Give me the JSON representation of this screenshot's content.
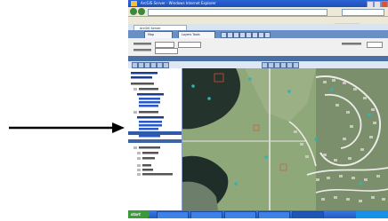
{
  "colors": {
    "arrow": "#000000",
    "titlebar": "#2a64d6",
    "taskbar": "#2f6fd8",
    "panel_header": "#3c65a8",
    "selected_row": "#2f5aa8",
    "map_water": "#1f2e28",
    "map_grass": "#8fa87a",
    "map_road": "#e8e8e4",
    "marker": "#2fb3b3"
  },
  "icons": {
    "arrow": "right-arrow-icon",
    "start": "windows-start-icon",
    "map_tools": "map-tool-icons"
  },
  "window": {
    "title": "ArcGIS Server - Windows Internet Explorer"
  },
  "browser": {
    "tab_label": "ArcGIS Server"
  },
  "app": {
    "buttons": [
      "Map",
      "Layers Tools"
    ]
  },
  "taskbar": {
    "start_label": "start"
  }
}
